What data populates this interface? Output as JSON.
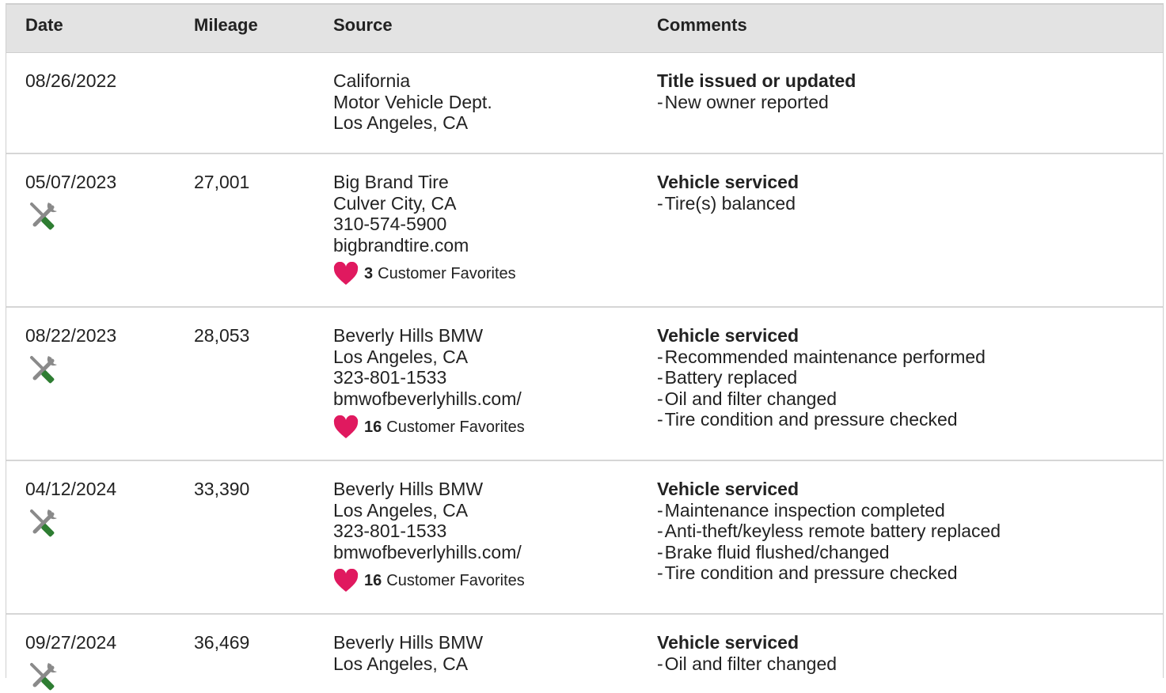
{
  "header": {
    "date": "Date",
    "mileage": "Mileage",
    "source": "Source",
    "comments": "Comments"
  },
  "favorites_label": "Customer Favorites",
  "colors": {
    "heart": "#e0195f",
    "wrench_green": "#2e7d32",
    "icon_gray": "#8a8a8a"
  },
  "icons": {
    "service": "service-tools-icon",
    "favorite": "heart-icon"
  },
  "rows": [
    {
      "date": "08/26/2022",
      "mileage": "",
      "source": [
        "California",
        "Motor Vehicle Dept.",
        "Los Angeles, CA"
      ],
      "favorites": "",
      "title": "Title issued or updated",
      "items": [
        "New owner reported"
      ]
    },
    {
      "date": "05/07/2023",
      "mileage": "27,001",
      "source": [
        "Big Brand Tire",
        "Culver City, CA",
        "310-574-5900",
        "bigbrandtire.com"
      ],
      "favorites": "3",
      "title": "Vehicle serviced",
      "items": [
        "Tire(s) balanced"
      ]
    },
    {
      "date": "08/22/2023",
      "mileage": "28,053",
      "source": [
        "Beverly Hills BMW",
        "Los Angeles, CA",
        "323-801-1533",
        "bmwofbeverlyhills.com/"
      ],
      "favorites": "16",
      "title": "Vehicle serviced",
      "items": [
        "Recommended maintenance performed",
        "Battery replaced",
        "Oil and filter changed",
        "Tire condition and pressure checked"
      ]
    },
    {
      "date": "04/12/2024",
      "mileage": "33,390",
      "source": [
        "Beverly Hills BMW",
        "Los Angeles, CA",
        "323-801-1533",
        "bmwofbeverlyhills.com/"
      ],
      "favorites": "16",
      "title": "Vehicle serviced",
      "items": [
        "Maintenance inspection completed",
        "Anti-theft/keyless remote battery replaced",
        "Brake fluid flushed/changed",
        "Tire condition and pressure checked"
      ]
    },
    {
      "date": "09/27/2024",
      "mileage": "36,469",
      "source": [
        "Beverly Hills BMW",
        "Los Angeles, CA"
      ],
      "favorites": "",
      "title": "Vehicle serviced",
      "items": [
        "Oil and filter changed"
      ]
    }
  ]
}
